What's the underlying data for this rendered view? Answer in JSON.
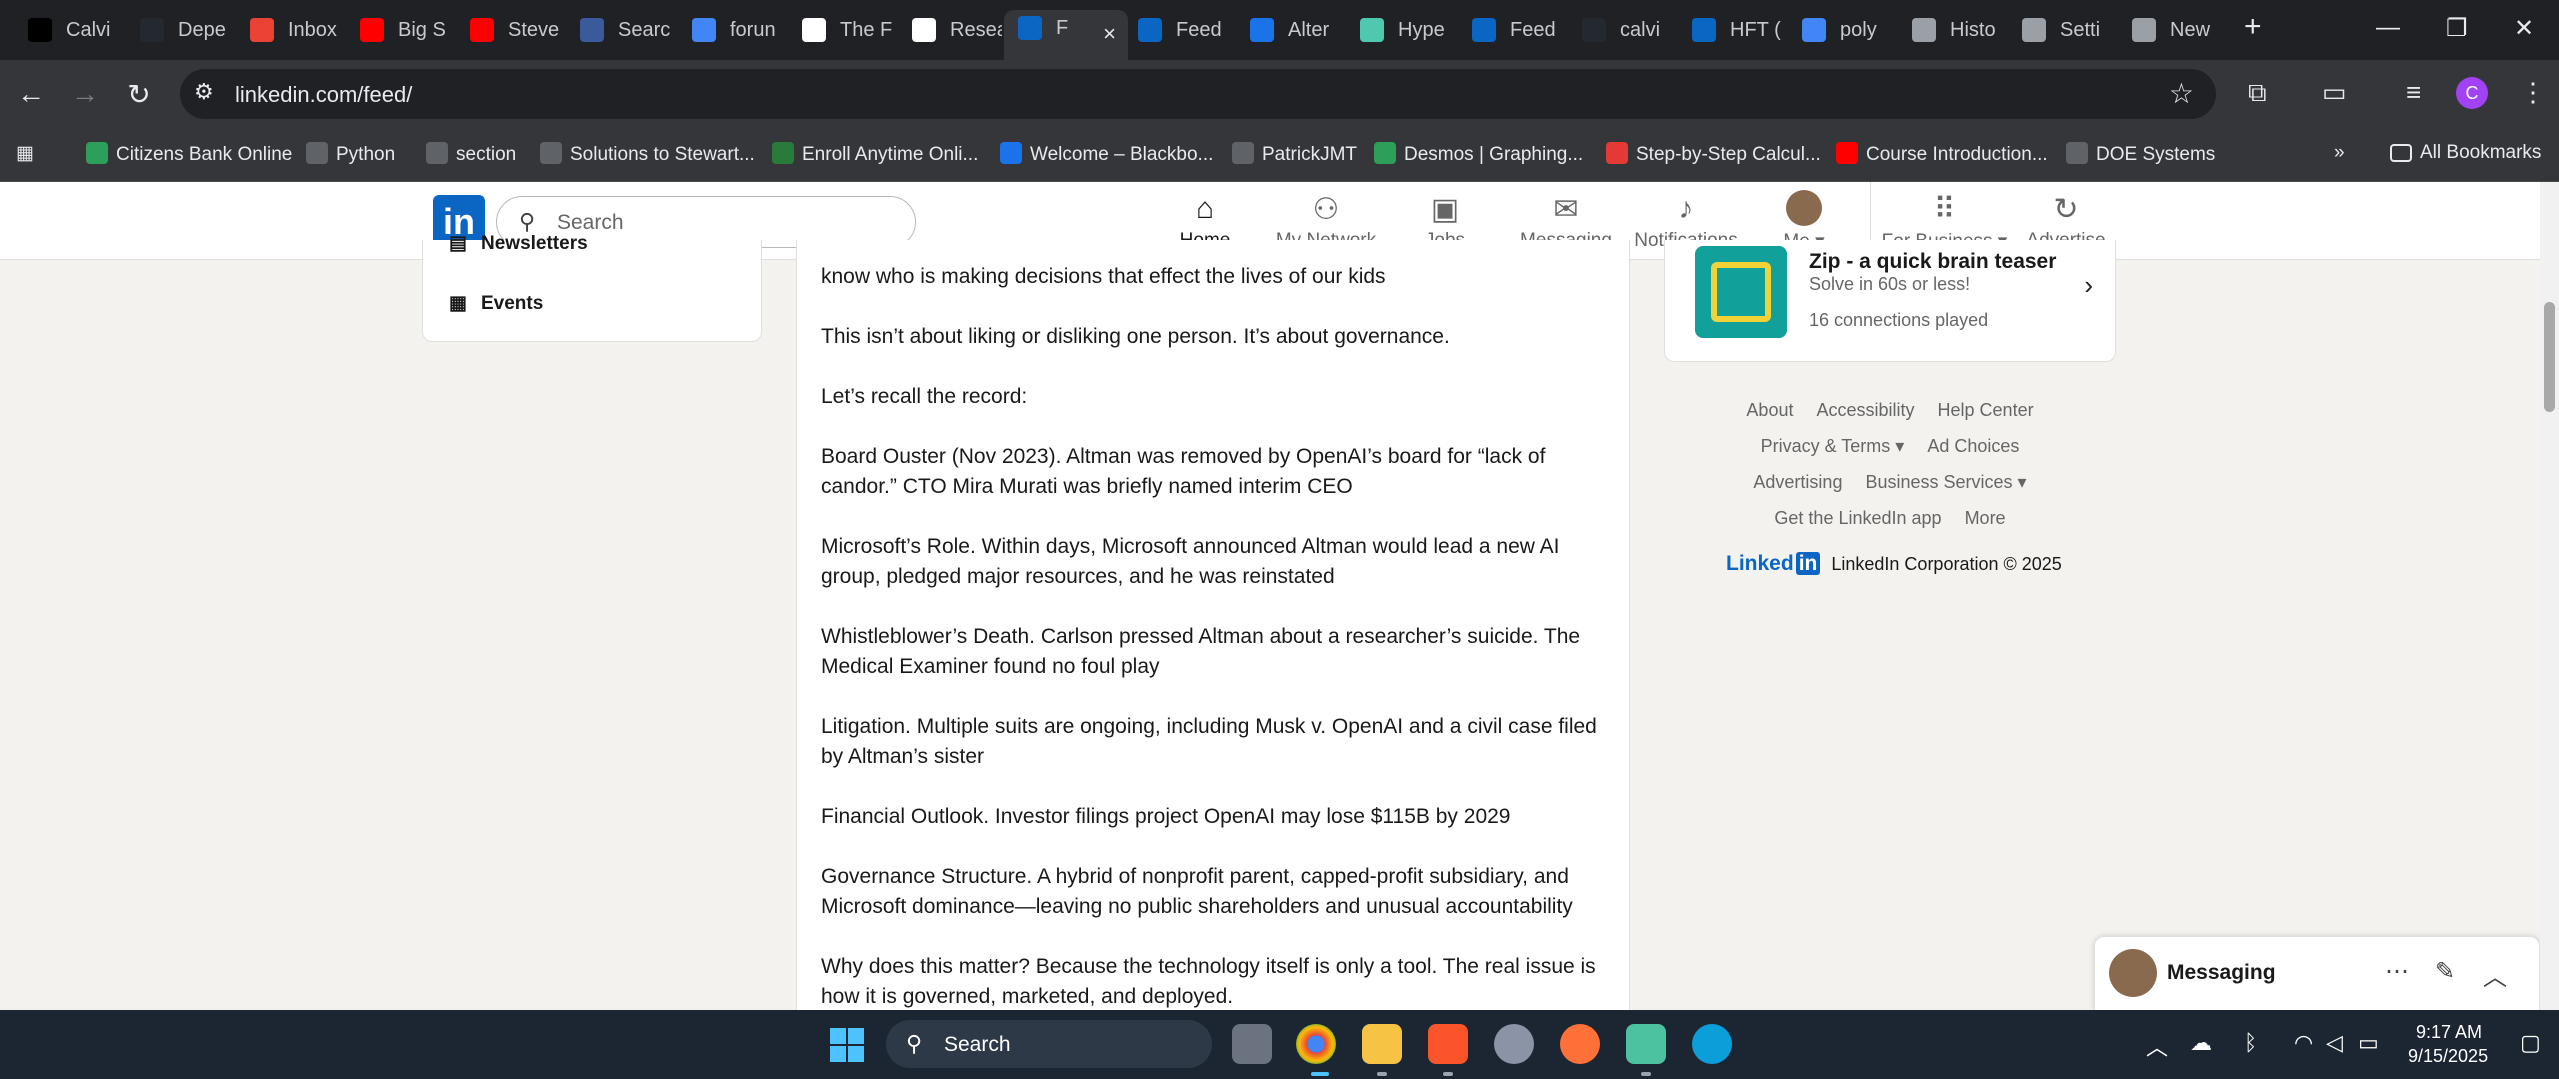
{
  "browser": {
    "tabs": [
      {
        "label": "Calvi",
        "icon": "x-icon",
        "color": "#000000"
      },
      {
        "label": "Depe",
        "icon": "github-icon",
        "color": "#24292f"
      },
      {
        "label": "Inbox",
        "icon": "gmail-icon",
        "color": "#ea4335"
      },
      {
        "label": "Big S",
        "icon": "youtube-icon",
        "color": "#ff0000"
      },
      {
        "label": "Steve",
        "icon": "youtube-icon",
        "color": "#ff0000"
      },
      {
        "label": "Searc",
        "icon": "ssrn-icon",
        "color": "#3a5a9c"
      },
      {
        "label": "forun",
        "icon": "google-icon",
        "color": "#4285f4"
      },
      {
        "label": "The F",
        "icon": "rg-icon",
        "color": "#ffffff"
      },
      {
        "label": "Resea",
        "icon": "rg-icon",
        "color": "#ffffff"
      },
      {
        "label": "F",
        "icon": "linkedin-icon",
        "color": "#0a66c2",
        "active": true
      },
      {
        "label": "Feed",
        "icon": "linkedin-icon",
        "color": "#0a66c2"
      },
      {
        "label": "Alter",
        "icon": "alter-icon",
        "color": "#1a73e8"
      },
      {
        "label": "Hype",
        "icon": "hype-icon",
        "color": "#4ec9b0"
      },
      {
        "label": "Feed",
        "icon": "linkedin-icon",
        "color": "#0a66c2"
      },
      {
        "label": "calvi",
        "icon": "github-icon",
        "color": "#24292f"
      },
      {
        "label": "HFT (",
        "icon": "linkedin-icon",
        "color": "#0a66c2"
      },
      {
        "label": "poly",
        "icon": "google-icon",
        "color": "#4285f4"
      },
      {
        "label": "Histo",
        "icon": "history-icon",
        "color": "#9aa0a6"
      },
      {
        "label": "Setti",
        "icon": "gear-icon",
        "color": "#9aa0a6"
      },
      {
        "label": "New",
        "icon": "chrome-icon",
        "color": "#9aa0a6"
      }
    ],
    "url": "linkedin.com/feed/",
    "profile_initial": "C",
    "bookmarks": [
      {
        "label": "Citizens Bank Online",
        "color": "#2e9e5b"
      },
      {
        "label": "Python",
        "color": "#5f6368"
      },
      {
        "label": "section",
        "color": "#5f6368"
      },
      {
        "label": "Solutions to Stewart...",
        "color": "#5f6368"
      },
      {
        "label": "Enroll Anytime Onli...",
        "color": "#2a7a3b"
      },
      {
        "label": "Welcome – Blackbo...",
        "color": "#1a73e8"
      },
      {
        "label": "PatrickJMT",
        "color": "#5f6368"
      },
      {
        "label": "Desmos | Graphing...",
        "color": "#2e9e5b"
      },
      {
        "label": "Step-by-Step Calcul...",
        "color": "#e53935"
      },
      {
        "label": "Course Introduction...",
        "color": "#ff0000"
      },
      {
        "label": "DOE Systems",
        "color": "#5f6368"
      }
    ],
    "all_bookmarks": "All Bookmarks"
  },
  "linkedin": {
    "logo": "in",
    "search_placeholder": "Search",
    "nav": {
      "home": "Home",
      "network": "My Network",
      "jobs": "Jobs",
      "messaging": "Messaging",
      "notifications": "Notifications",
      "me": "Me",
      "business": "For Business",
      "advertise": "Advertise"
    },
    "left_menu": {
      "newsletters": "Newsletters",
      "events": "Events"
    },
    "post_paragraphs": [
      "know who is making decisions that effect the lives of our kids",
      "This isn’t about liking or disliking one person. It’s about governance.",
      "Let’s recall the record:",
      "Board Ouster (Nov 2023). Altman was removed by OpenAI’s board for “lack of candor.” CTO Mira Murati was briefly named interim CEO",
      "Microsoft’s Role. Within days, Microsoft announced Altman would lead a new AI group, pledged major resources, and he was reinstated",
      "Whistleblower’s Death. Carlson pressed Altman about a researcher’s suicide. The Medical Examiner found no foul play",
      "Litigation. Multiple suits are ongoing, including Musk v. OpenAI and a civil case filed by Altman’s sister",
      "Financial Outlook. Investor filings project OpenAI may lose $115B by 2029",
      "Governance Structure. A hybrid of nonprofit parent, capped-profit subsidiary, and Microsoft dominance—leaving no public shareholders and unusual accountability",
      "Why does this matter? Because the technology itself is only a tool. The real issue is how it is governed, marketed, and deployed."
    ],
    "zip": {
      "title": "Zip - a quick brain teaser",
      "subtitle": "Solve in 60s or less!",
      "played": "16 connections played"
    },
    "footer": {
      "about": "About",
      "accessibility": "Accessibility",
      "help": "Help Center",
      "privacy": "Privacy & Terms",
      "ad_choices": "Ad Choices",
      "advertising": "Advertising",
      "business_services": "Business Services",
      "get_app": "Get the LinkedIn app",
      "more": "More",
      "wordmark": "Linked",
      "copyright": "LinkedIn Corporation © 2025"
    },
    "messaging_bar": "Messaging"
  },
  "taskbar": {
    "search": "Search",
    "time": "9:17 AM",
    "date": "9/15/2025"
  }
}
